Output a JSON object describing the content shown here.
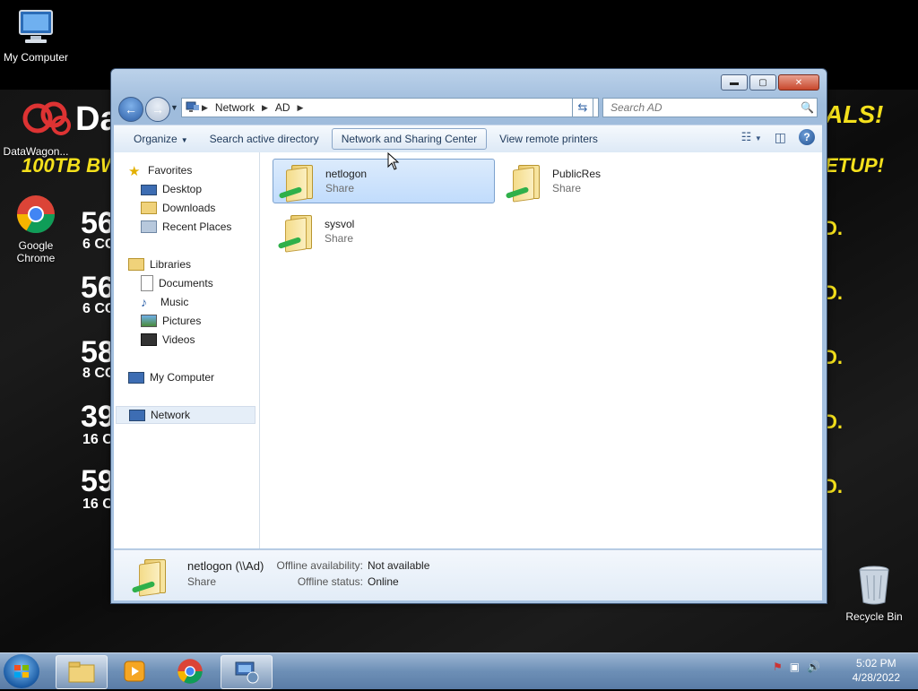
{
  "desktop": {
    "icons": [
      {
        "label": "My Computer"
      },
      {
        "label": "DataWagon..."
      },
      {
        "label": "Google Chrome"
      },
      {
        "label": "Recycle Bin"
      }
    ],
    "wallpaper": {
      "brand": "Da",
      "banner_left": "100TB BW",
      "banner_right_top": "ALS!",
      "banner_right_mid": "ETUP!",
      "rows": [
        {
          "num": "56",
          "sub": "6 CC"
        },
        {
          "num": "56",
          "sub": "6 CC"
        },
        {
          "num": "58",
          "sub": "8 CC"
        },
        {
          "num": "39",
          "sub": "16 C"
        },
        {
          "num": "59",
          "sub": "16 C"
        }
      ],
      "dot": "D."
    }
  },
  "window": {
    "address": {
      "segments": [
        "Network",
        "AD"
      ]
    },
    "search_placeholder": "Search AD",
    "toolbar": {
      "organize": "Organize",
      "search_ad": "Search active directory",
      "network_sharing": "Network and Sharing Center",
      "remote_printers": "View remote printers"
    },
    "nav": {
      "favorites": "Favorites",
      "desktop": "Desktop",
      "downloads": "Downloads",
      "recent": "Recent Places",
      "libraries": "Libraries",
      "documents": "Documents",
      "music": "Music",
      "pictures": "Pictures",
      "videos": "Videos",
      "my_computer": "My Computer",
      "network": "Network"
    },
    "items": [
      {
        "name": "netlogon",
        "type": "Share"
      },
      {
        "name": "PublicRes",
        "type": "Share"
      },
      {
        "name": "sysvol",
        "type": "Share"
      }
    ],
    "details": {
      "name": "netlogon (\\\\Ad)",
      "type": "Share",
      "offline_availability_label": "Offline availability:",
      "offline_availability_value": "Not available",
      "offline_status_label": "Offline status:",
      "offline_status_value": "Online"
    }
  },
  "taskbar": {
    "time": "5:02 PM",
    "date": "4/28/2022"
  }
}
